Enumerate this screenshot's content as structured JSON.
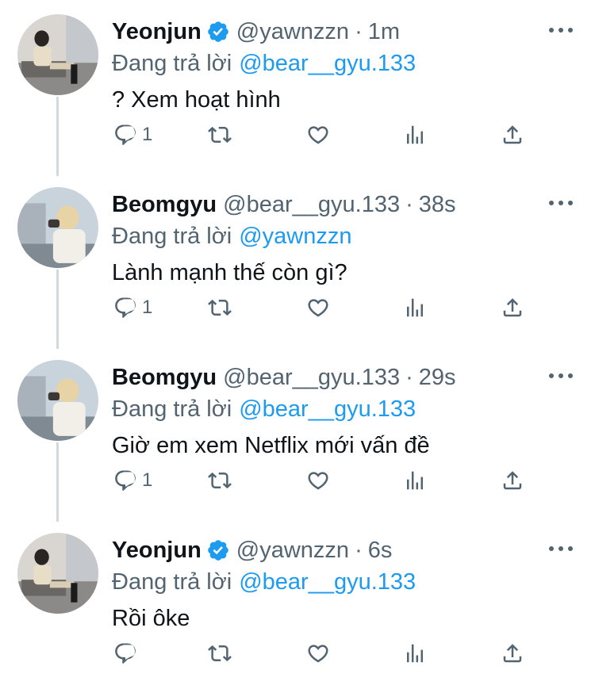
{
  "colors": {
    "accent": "#1d9bf0",
    "secondary_text": "#536471",
    "thread_line": "#cfd9de"
  },
  "tweets": [
    {
      "name": "Yeonjun",
      "verified": true,
      "handle": "@yawnzzn",
      "dot": "·",
      "time": "1m",
      "reply_prefix": "Đang trả lời",
      "reply_mention": "@bear__gyu.133",
      "text": "? Xem hoạt hình",
      "reply_count": "1",
      "avatar": "avatar-yeonjun"
    },
    {
      "name": "Beomgyu",
      "verified": false,
      "handle": "@bear__gyu.133",
      "dot": "·",
      "time": "38s",
      "reply_prefix": "Đang trả lời",
      "reply_mention": "@yawnzzn",
      "text": "Lành mạnh thế còn gì?",
      "reply_count": "1",
      "avatar": "avatar-beomgyu"
    },
    {
      "name": "Beomgyu",
      "verified": false,
      "handle": "@bear__gyu.133",
      "dot": "·",
      "time": "29s",
      "reply_prefix": "Đang trả lời",
      "reply_mention": "@bear__gyu.133",
      "text": "Giờ em xem Netflix mới vấn đề",
      "reply_count": "1",
      "avatar": "avatar-beomgyu"
    },
    {
      "name": "Yeonjun",
      "verified": true,
      "handle": "@yawnzzn",
      "dot": "·",
      "time": "6s",
      "reply_prefix": "Đang trả lời",
      "reply_mention": "@bear__gyu.133",
      "text": "Rồi ôke",
      "reply_count": "",
      "avatar": "avatar-yeonjun"
    }
  ],
  "icons": {
    "more": "more-dots-icon",
    "reply": "reply-icon",
    "retweet": "retweet-icon",
    "like": "heart-icon",
    "views": "analytics-icon",
    "share": "share-icon",
    "verified": "verified-badge-icon"
  }
}
